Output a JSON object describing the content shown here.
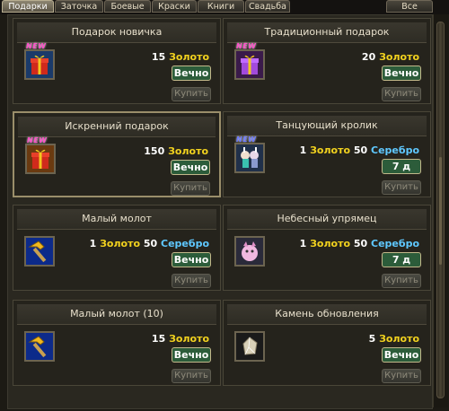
{
  "tabs": [
    "Подарки",
    "Заточка",
    "Боевые",
    "Краски",
    "Книги",
    "Свадьба",
    "Все"
  ],
  "badge_new": "NEW",
  "buy_label": "Купить",
  "currency": {
    "gold": "Золото",
    "silver": "Серебро"
  },
  "items": [
    {
      "title": "Подарок новичка",
      "gold": "15",
      "silver": "",
      "duration": "Вечно",
      "icon": "gift-red-icon",
      "new": true
    },
    {
      "title": "Традиционный подарок",
      "gold": "20",
      "silver": "",
      "duration": "Вечно",
      "icon": "gift-purple-icon",
      "new": true
    },
    {
      "title": "Искренний подарок",
      "gold": "150",
      "silver": "",
      "duration": "Вечно",
      "icon": "gift-red-icon",
      "new": true
    },
    {
      "title": "Танцующий кролик",
      "gold": "1",
      "silver": "50",
      "duration": "7 д",
      "icon": "dancing-rabbit-icon",
      "new": true
    },
    {
      "title": "Малый молот",
      "gold": "1",
      "silver": "50",
      "duration": "Вечно",
      "icon": "hammer-icon",
      "new": false
    },
    {
      "title": "Небесный упрямец",
      "gold": "1",
      "silver": "50",
      "duration": "7 д",
      "icon": "pink-creature-icon",
      "new": false
    },
    {
      "title": "Малый молот (10)",
      "gold": "15",
      "silver": "",
      "duration": "Вечно",
      "icon": "hammer-icon",
      "new": false
    },
    {
      "title": "Камень обновления",
      "gold": "5",
      "silver": "",
      "duration": "Вечно",
      "icon": "crystal-stone-icon",
      "new": false
    }
  ],
  "colors": {
    "gold": "#f2d21e",
    "silver": "#5fc8ff",
    "duration_bg": "#2c5c3a"
  }
}
